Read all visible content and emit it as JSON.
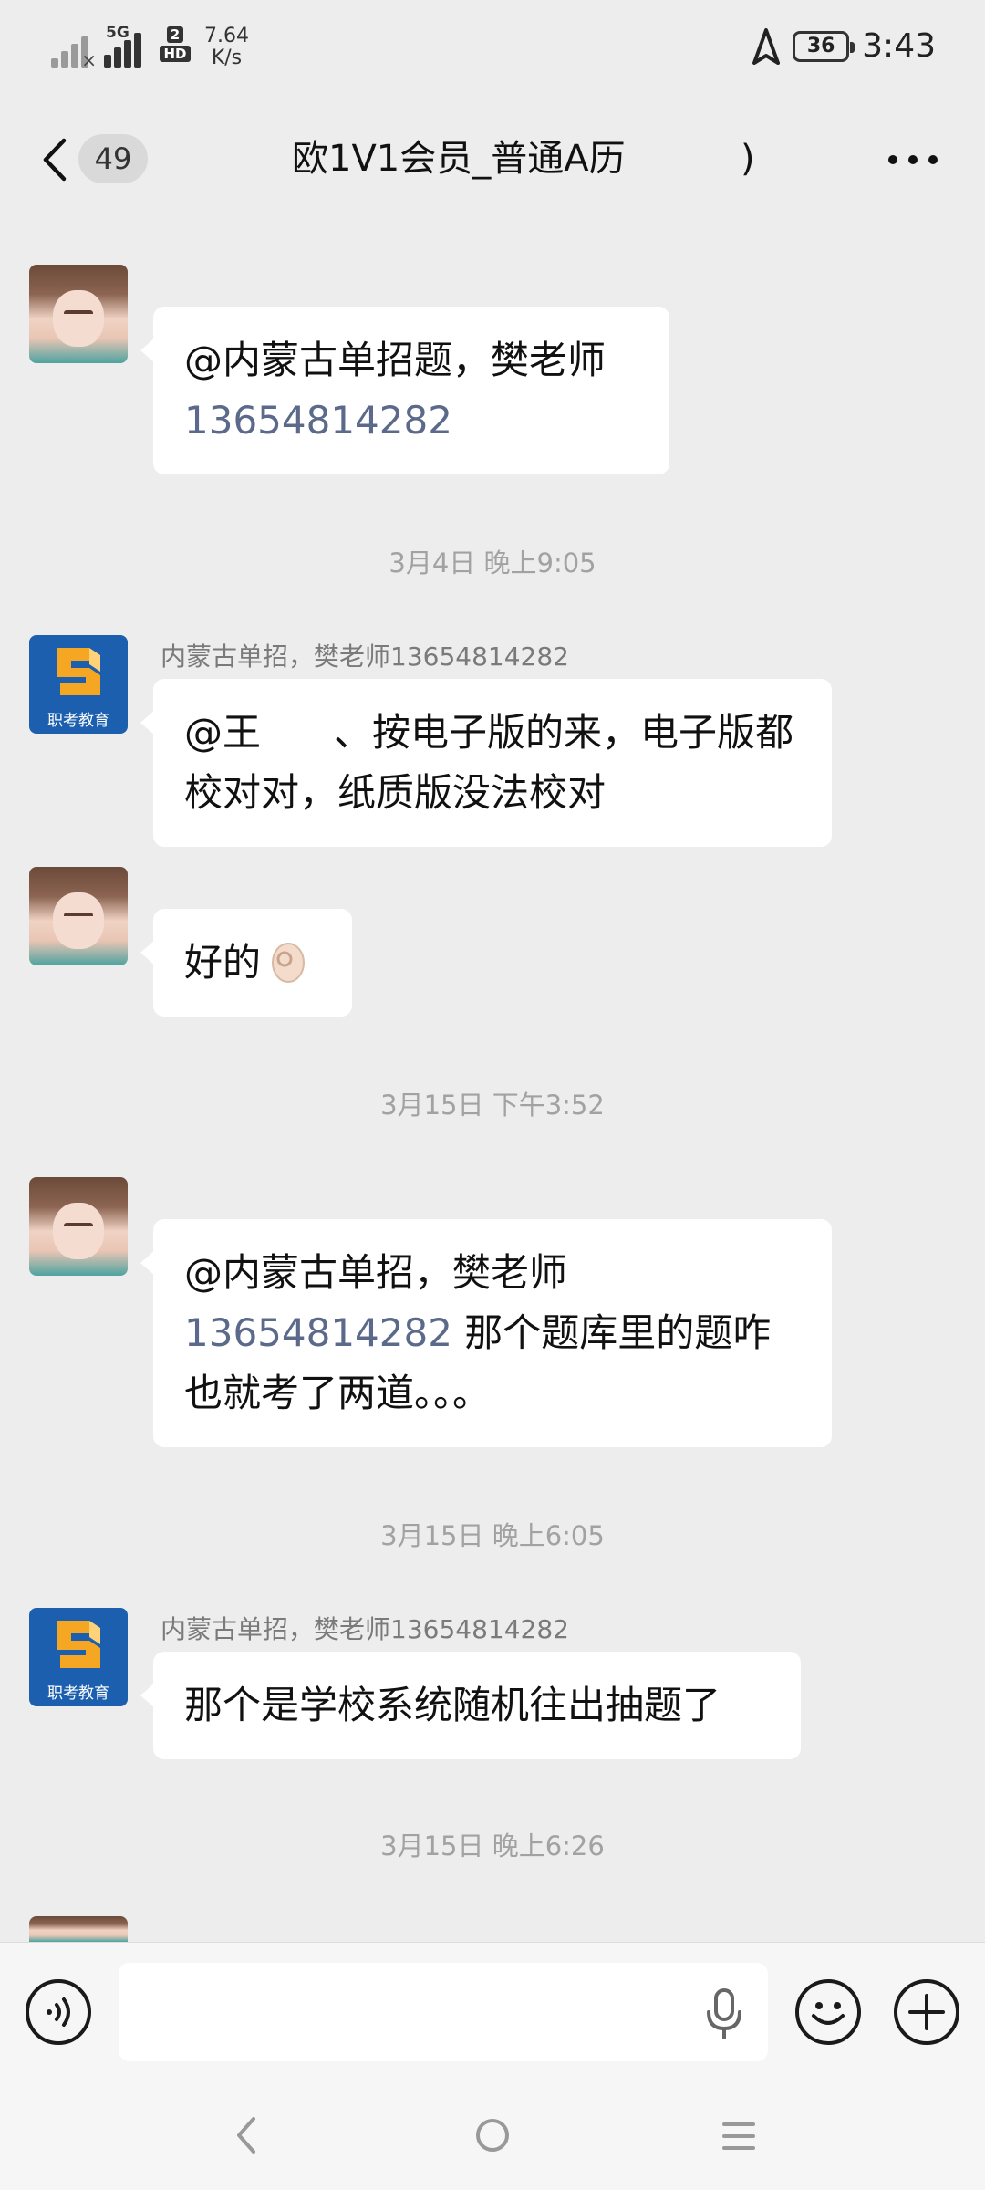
{
  "status_bar": {
    "network_type": "5G",
    "hd_badge_top": "2",
    "hd_badge_bottom": "HD",
    "net_speed_value": "7.64",
    "net_speed_unit": "K/s",
    "battery": "36",
    "time": "3:43"
  },
  "header": {
    "unread_count": "49",
    "title": "欧1V1会员_普通A历",
    "title_tail": ")"
  },
  "messages": [
    {
      "sender": "",
      "text": "@内蒙古单招题，樊老师",
      "phone": "13654814282",
      "after": ""
    },
    {
      "timestamp": "3月4日 晚上9:05"
    },
    {
      "sender": "内蒙古单招，樊老师13654814282",
      "text_a": "@王",
      "text_b": "、按电子版的来，电子版都校对对，纸质版没法校对"
    },
    {
      "sender": "",
      "text": "好的"
    },
    {
      "timestamp": "3月15日 下午3:52"
    },
    {
      "sender": "",
      "text": "@内蒙古单招，樊老师",
      "phone": "13654814282",
      "after": " 那个题库里的题咋也就考了两道。。。"
    },
    {
      "timestamp": "3月15日 晚上6:05"
    },
    {
      "sender": "内蒙古单招，樊老师13654814282",
      "text": "那个是学校系统随机往出抽题了"
    },
    {
      "timestamp": "3月15日 晚上6:26"
    }
  ],
  "org_avatar_text": "职考教育",
  "input": {
    "value": "",
    "placeholder": ""
  },
  "icons": {
    "voice": "voice-toggle-icon",
    "mic": "microphone-icon",
    "emoji": "emoji-icon",
    "plus": "plus-icon"
  }
}
